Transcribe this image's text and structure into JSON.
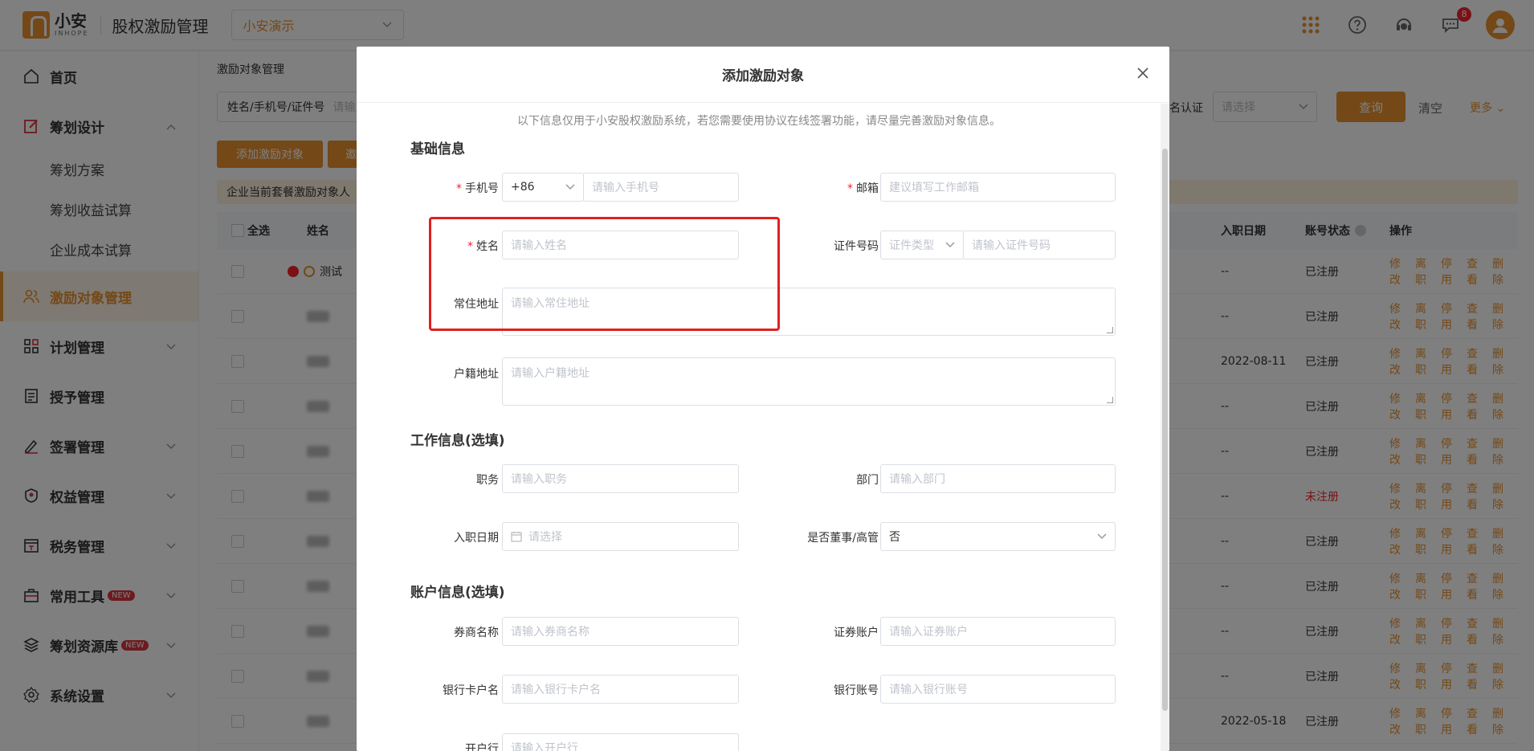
{
  "header": {
    "logo_cn": "小安",
    "logo_en": "INHOPE",
    "app_title": "股权激励管理",
    "company": "小安演示",
    "message_badge": "8"
  },
  "sidebar": {
    "items": [
      {
        "label": "首页",
        "icon": "home-icon"
      },
      {
        "label": "筹划设计",
        "icon": "edit-icon",
        "expanded": true
      },
      {
        "label": "筹划方案"
      },
      {
        "label": "筹划收益试算"
      },
      {
        "label": "企业成本试算"
      },
      {
        "label": "激励对象管理",
        "icon": "users-icon",
        "active": true
      },
      {
        "label": "计划管理",
        "icon": "grid-icon"
      },
      {
        "label": "授予管理",
        "icon": "book-icon"
      },
      {
        "label": "签署管理",
        "icon": "pen-icon"
      },
      {
        "label": "权益管理",
        "icon": "rights-icon"
      },
      {
        "label": "税务管理",
        "icon": "tax-icon"
      },
      {
        "label": "常用工具",
        "icon": "toolbox-icon",
        "badge": "NEW"
      },
      {
        "label": "筹划资源库",
        "icon": "layers-icon",
        "badge": "NEW"
      },
      {
        "label": "系统设置",
        "icon": "settings-icon"
      }
    ]
  },
  "main": {
    "breadcrumb": "激励对象管理",
    "search_label": "姓名/手机号/证件号",
    "search_placeholder": "请输入",
    "auth_label": "名认证",
    "auth_placeholder": "请选择",
    "query_button": "查询",
    "clear_button": "清空",
    "more_button": "更多",
    "add_button": "添加激励对象",
    "second_button": "邀",
    "notice": "企业当前套餐激励对象人",
    "table": {
      "headers": {
        "select_all": "全选",
        "name": "姓名",
        "entry_date": "入职日期",
        "account_status": "账号状态",
        "actions": "操作"
      },
      "first_row_name": "测试",
      "rows": [
        {
          "date": "--",
          "status": "已注册"
        },
        {
          "date": "--",
          "status": "已注册"
        },
        {
          "date": "2022-08-11",
          "status": "已注册"
        },
        {
          "date": "--",
          "status": "已注册"
        },
        {
          "date": "--",
          "status": "已注册"
        },
        {
          "date": "--",
          "status": "未注册"
        },
        {
          "date": "--",
          "status": "已注册"
        },
        {
          "date": "--",
          "status": "已注册"
        },
        {
          "date": "--",
          "status": "已注册"
        },
        {
          "date": "--",
          "status": "已注册"
        },
        {
          "date": "2022-05-18",
          "status": "已注册"
        }
      ],
      "ops": {
        "edit": "修改",
        "leave": "离职",
        "disable": "停用",
        "view": "查看",
        "delete": "删除"
      }
    }
  },
  "modal": {
    "title": "添加激励对象",
    "tip": "以下信息仅用于小安股权激励系统，若您需要使用协议在线签署功能，请尽量完善激励对象信息。",
    "sections": {
      "basic": "基础信息",
      "work": "工作信息(选填)",
      "account": "账户信息(选填)"
    },
    "fields": {
      "phone": {
        "label": "手机号",
        "prefix": "+86",
        "placeholder": "请输入手机号"
      },
      "email": {
        "label": "邮箱",
        "placeholder": "建议填写工作邮箱"
      },
      "name": {
        "label": "姓名",
        "placeholder": "请输入姓名"
      },
      "id": {
        "label": "证件号码",
        "type_placeholder": "证件类型",
        "placeholder": "请输入证件号码"
      },
      "address": {
        "label": "常住地址",
        "placeholder": "请输入常住地址"
      },
      "household": {
        "label": "户籍地址",
        "placeholder": "请输入户籍地址"
      },
      "position": {
        "label": "职务",
        "placeholder": "请输入职务"
      },
      "department": {
        "label": "部门",
        "placeholder": "请输入部门"
      },
      "entry_date": {
        "label": "入职日期",
        "placeholder": "请选择"
      },
      "director": {
        "label": "是否董事/高管",
        "value": "否"
      },
      "broker": {
        "label": "券商名称",
        "placeholder": "请输入券商名称"
      },
      "securities": {
        "label": "证券账户",
        "placeholder": "请输入证券账户"
      },
      "bank_name": {
        "label": "银行卡户名",
        "placeholder": "请输入银行卡户名"
      },
      "bank_account": {
        "label": "银行账号",
        "placeholder": "请输入银行账号"
      },
      "bank_branch": {
        "label": "开户行",
        "placeholder": "请输入开户行"
      }
    }
  }
}
